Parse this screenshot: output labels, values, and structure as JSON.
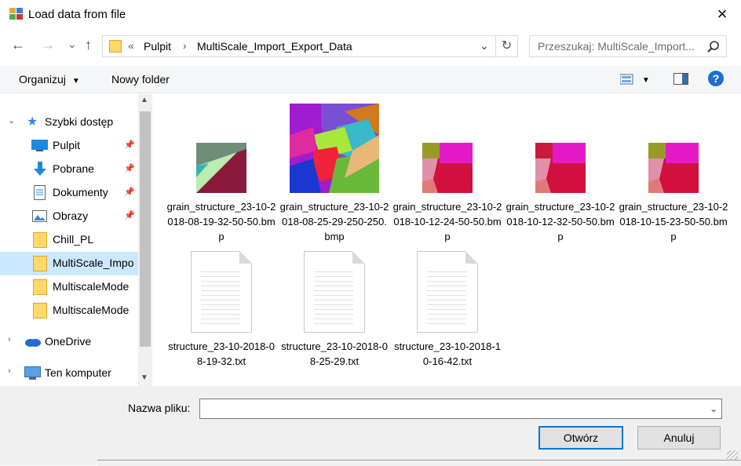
{
  "window": {
    "title": "Load data from file",
    "close_glyph": "×"
  },
  "address_bar": {
    "back_glyph": "←",
    "forward_glyph": "→",
    "recent_glyph": "⌄",
    "up_glyph": "↑",
    "overflow": "«",
    "crumbs": [
      "Pulpit",
      "MultiScale_Import_Export_Data"
    ],
    "separator": "›",
    "dropdown_glyph": "⌄",
    "refresh_glyph": "↻"
  },
  "search": {
    "placeholder": "Przeszukaj: MultiScale_Import...",
    "icon": "search-icon"
  },
  "toolbar": {
    "organize_label": "Organizuj",
    "new_folder_label": "Nowy folder",
    "help_glyph": "?"
  },
  "nav": {
    "quick_access": "Szybki dostęp",
    "items": [
      {
        "label": "Pulpit",
        "icon": "desktop-icon",
        "pinned": true
      },
      {
        "label": "Pobrane",
        "icon": "download-icon",
        "pinned": true
      },
      {
        "label": "Dokumenty",
        "icon": "documents-icon",
        "pinned": true
      },
      {
        "label": "Obrazy",
        "icon": "pictures-icon",
        "pinned": true
      },
      {
        "label": "Chill_PL",
        "icon": "folder-icon",
        "pinned": false
      },
      {
        "label": "MultiScale_Impo",
        "icon": "folder-icon",
        "pinned": false,
        "selected": true
      },
      {
        "label": "MultiscaleMode",
        "icon": "folder-icon",
        "pinned": false
      },
      {
        "label": "MultiscaleMode",
        "icon": "folder-icon",
        "pinned": false
      }
    ],
    "onedrive": "OneDrive",
    "this_pc": "Ten komputer",
    "pin_glyph": "📌"
  },
  "files": [
    {
      "name": "grain_structure_23-10-2018-08-19-32-50-50.bmp",
      "type": "bmp"
    },
    {
      "name": "grain_structure_23-10-2018-08-25-29-250-250.bmp",
      "type": "bmp"
    },
    {
      "name": "grain_structure_23-10-2018-10-12-24-50-50.bmp",
      "type": "bmp"
    },
    {
      "name": "grain_structure_23-10-2018-10-12-32-50-50.bmp",
      "type": "bmp"
    },
    {
      "name": "grain_structure_23-10-2018-10-15-23-50-50.bmp",
      "type": "bmp"
    },
    {
      "name": "structure_23-10-2018-08-19-32.txt",
      "type": "txt"
    },
    {
      "name": "structure_23-10-2018-08-25-29.txt",
      "type": "txt"
    },
    {
      "name": "structure_23-10-2018-10-16-42.txt",
      "type": "txt"
    }
  ],
  "bottom": {
    "filename_label": "Nazwa pliku:",
    "filename_value": "",
    "open_label": "Otwórz",
    "cancel_label": "Anuluj"
  },
  "colors": {
    "accent": "#0078d7",
    "selected_bg": "#cce8ff"
  }
}
